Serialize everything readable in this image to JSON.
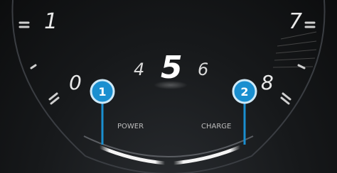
{
  "gauge": {
    "scale_left": [
      "1",
      "0"
    ],
    "scale_right": [
      "7",
      "8"
    ],
    "label_power": "POWER",
    "label_charge": "CHARGE"
  },
  "gear": {
    "previous": "4",
    "current": "5",
    "next": "6"
  },
  "callouts": [
    {
      "number": "1"
    },
    {
      "number": "2"
    }
  ],
  "colors": {
    "callout_fill": "#1a8fd0",
    "callout_stroke": "#cfe9f7",
    "glow": "#ffffff",
    "text": "#e9e9e9"
  }
}
